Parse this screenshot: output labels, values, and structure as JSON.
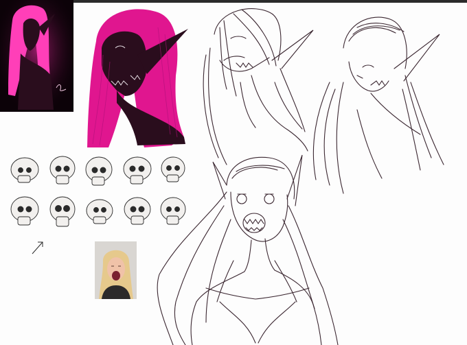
{
  "artwork": {
    "palette": {
      "background": "#fdfdfd",
      "sketch_line": "#3a2630",
      "hair_pink": "#e0168f",
      "skin_dark": "#2a0d1d",
      "glow_pink": "#ff2fb0",
      "thumb_bg": "#0c0208"
    },
    "panels": [
      "glowing-portrait-thumbnail",
      "colored-elf-profile",
      "sketch-elf-looking-up",
      "sketch-elf-three-quarter",
      "skull-reference-sheet",
      "photo-reference",
      "sketch-elf-open-mouth-bust"
    ],
    "skull_count": 10,
    "signature": "Ae"
  }
}
